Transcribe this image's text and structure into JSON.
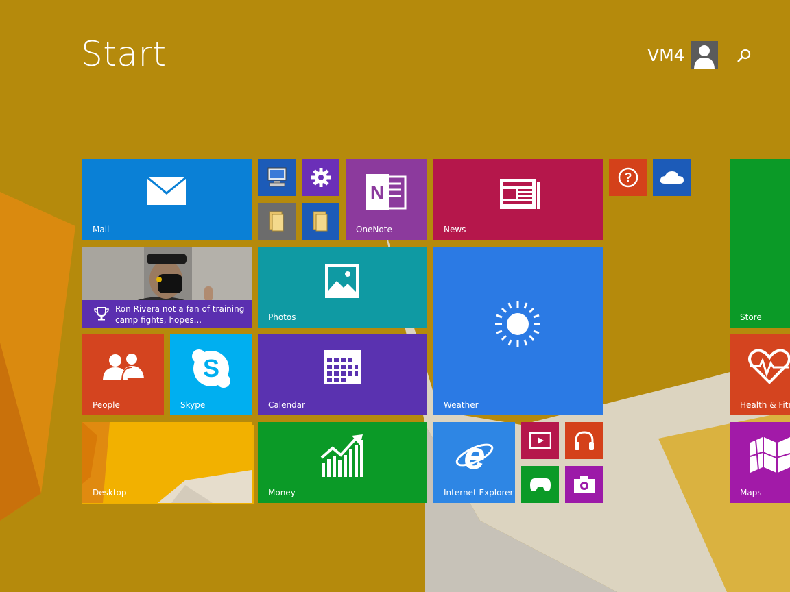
{
  "header": {
    "title": "Start",
    "user_name": "VM4"
  },
  "tiles": {
    "mail": {
      "label": "Mail",
      "color": "#0a80d6",
      "icon": "mail-icon"
    },
    "computer": {
      "color": "#1c5bb8",
      "icon": "computer-icon"
    },
    "settings": {
      "color": "#6b2fb8",
      "icon": "gear-icon"
    },
    "file_explorer_1": {
      "color": "#6c6c6c",
      "icon": "folder-icon"
    },
    "file_explorer_2": {
      "color": "#1c5bb8",
      "icon": "folder-icon"
    },
    "onenote": {
      "label": "OneNote",
      "color": "#8c3a9d",
      "icon": "onenote-icon"
    },
    "news": {
      "label": "News",
      "color": "#b5174b",
      "icon": "newspaper-icon"
    },
    "help": {
      "color": "#d4411a",
      "icon": "help-icon"
    },
    "onedrive": {
      "color": "#1c5bb8",
      "icon": "cloud-icon"
    },
    "sports": {
      "headline": "Ron Rivera not a fan of training camp fights, hopes...",
      "icon": "trophy-icon",
      "banner_color": "#5b2fb0"
    },
    "photos": {
      "label": "Photos",
      "color": "#0f9aa3",
      "icon": "photo-icon"
    },
    "weather": {
      "label": "Weather",
      "color": "#2b7ae4",
      "icon": "sun-icon"
    },
    "people": {
      "label": "People",
      "color": "#d4441f",
      "icon": "people-icon"
    },
    "skype": {
      "label": "Skype",
      "color": "#00aff0",
      "icon": "skype-icon"
    },
    "calendar": {
      "label": "Calendar",
      "color": "#5a32b0",
      "icon": "calendar-icon"
    },
    "desktop": {
      "label": "Desktop",
      "color": "#e9a400"
    },
    "money": {
      "label": "Money",
      "color": "#0b9a27",
      "icon": "chart-icon"
    },
    "internet_explorer": {
      "label": "Internet Explorer",
      "color": "#2e86e4",
      "icon": "ie-icon"
    },
    "video": {
      "color": "#b5174b",
      "icon": "video-icon"
    },
    "music": {
      "color": "#d4411a",
      "icon": "headphones-icon"
    },
    "games": {
      "color": "#0b9a27",
      "icon": "game-controller-icon"
    },
    "camera": {
      "color": "#9c1aa8",
      "icon": "camera-icon"
    },
    "store": {
      "label": "Store",
      "color": "#0b9a27"
    },
    "health": {
      "label": "Health & Fitne",
      "color": "#d4441f",
      "icon": "heart-icon"
    },
    "maps": {
      "label": "Maps",
      "color": "#a21aa8",
      "icon": "map-icon"
    }
  }
}
